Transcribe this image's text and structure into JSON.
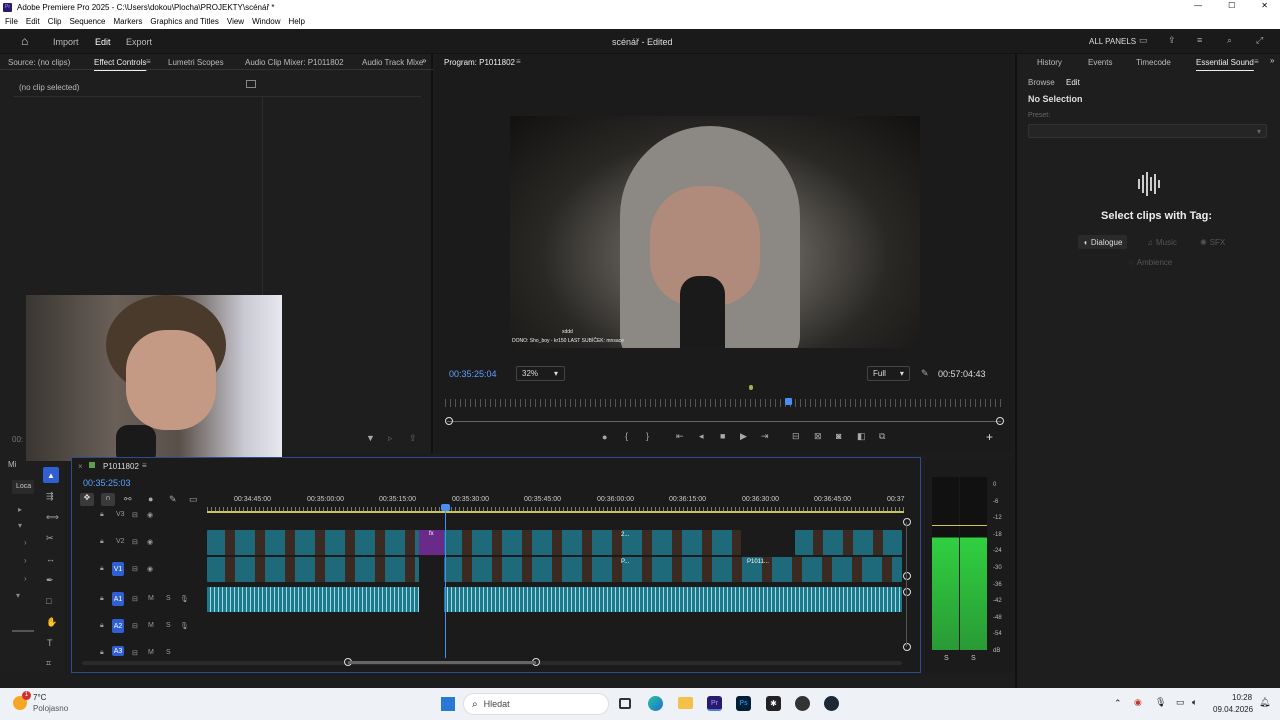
{
  "window": {
    "title": "Adobe Premiere Pro 2025 - C:\\Users\\dokou\\Plocha\\PROJEKTY\\scénář *",
    "controls": [
      "—",
      "☐",
      "✕"
    ]
  },
  "menu": [
    "File",
    "Edit",
    "Clip",
    "Sequence",
    "Markers",
    "Graphics and Titles",
    "View",
    "Window",
    "Help"
  ],
  "header": {
    "nav": [
      "Import",
      "Edit",
      "Export"
    ],
    "active": "Edit",
    "project_title": "scénář - Edited",
    "all_panels": "ALL PANELS"
  },
  "source_panel": {
    "tabs": [
      "Source: (no clips)",
      "Effect Controls",
      "Lumetri Scopes",
      "Audio Clip Mixer: P1011802",
      "Audio Track Mixe"
    ],
    "active": "Effect Controls",
    "empty_text": "(no clip selected)",
    "partial_time": "00:"
  },
  "program": {
    "tab": "Program: P1011802",
    "timecode": "00:35:25:04",
    "zoom": "32%",
    "quality": "Full",
    "duration": "00:57:04:43",
    "overlay_line1": "xddd",
    "overlay_line2": "DONO: Sho_boy - kr150   LAST SUBÍČEK: mnsace"
  },
  "essential_sound": {
    "tabs": [
      "History",
      "Events",
      "Timecode",
      "Essential Sound"
    ],
    "active": "Essential Sound",
    "subtabs": [
      "Browse",
      "Edit"
    ],
    "active_subtab": "Edit",
    "selection": "No Selection",
    "preset_label": "Preset:",
    "heading": "Select clips with Tag:",
    "tags": [
      "Dialogue",
      "Music",
      "SFX",
      "Ambience"
    ]
  },
  "timeline": {
    "sequence": "P1011802",
    "timecode": "00:35:25:03",
    "ruler": [
      "00:34:45:00",
      "00:35:00:00",
      "00:35:15:00",
      "00:35:30:00",
      "00:35:45:00",
      "00:36:00:00",
      "00:36:15:00",
      "00:36:30:00",
      "00:36:45:00",
      "00:37"
    ],
    "tracks": [
      "V3",
      "V2",
      "V1",
      "A1",
      "A2",
      "A3"
    ],
    "mute_label": "M",
    "solo_label": "S",
    "clip_labels": [
      "2...",
      "P...",
      "P1011..."
    ],
    "fx_label": "fx",
    "left_panel_labels": [
      "Mi",
      "Loca"
    ]
  },
  "meter": {
    "scale": [
      "0",
      "-6",
      "-12",
      "-18",
      "-24",
      "-30",
      "-36",
      "-42",
      "-48",
      "-54",
      "dB"
    ],
    "solo": [
      "S",
      "S"
    ]
  },
  "taskbar": {
    "weather_temp": "7°C",
    "weather_desc": "Polojasno",
    "search": "Hledat",
    "time": "10:28",
    "date": "09.04.2026",
    "badge": "1"
  }
}
